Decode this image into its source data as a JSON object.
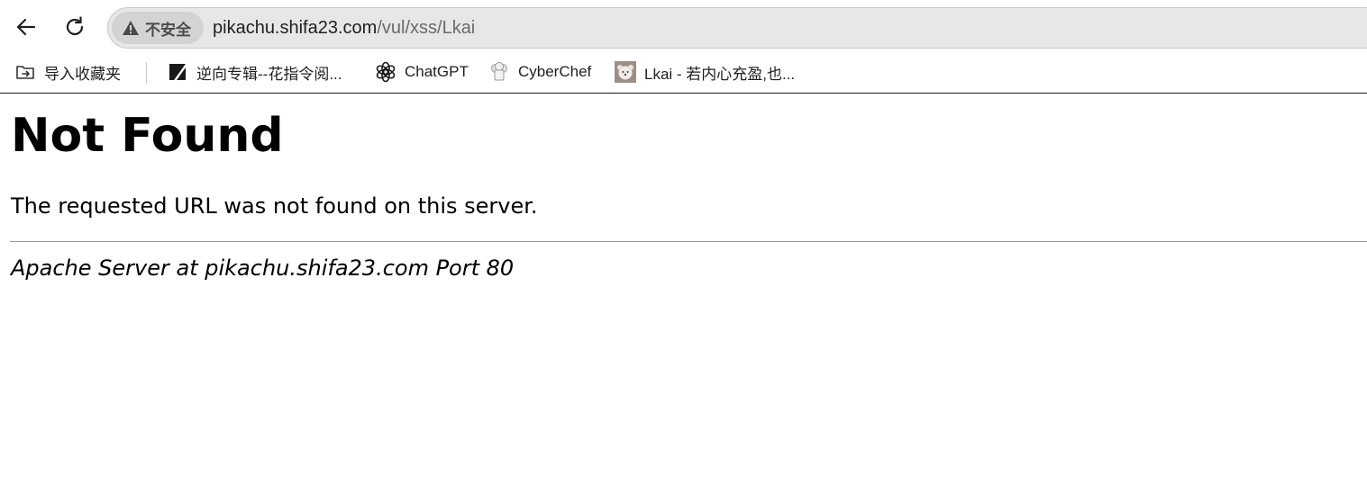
{
  "browser": {
    "security_label": "不安全",
    "url_host": "pikachu.shifa23.com",
    "url_path": "/vul/xss/Lkai",
    "icons": {
      "back": "back-arrow-icon",
      "reload": "reload-icon",
      "security": "warning-triangle-icon"
    }
  },
  "bookmarks": {
    "items": [
      {
        "label": "导入收藏夹",
        "icon": "import-favorites-icon"
      },
      {
        "label": "逆向专辑--花指令阅...",
        "icon": "site-favicon"
      },
      {
        "label": "ChatGPT",
        "icon": "chatgpt-icon"
      },
      {
        "label": "CyberChef",
        "icon": "cyberchef-icon"
      },
      {
        "label": "Lkai - 若内心充盈,也...",
        "icon": "avatar-favicon"
      }
    ]
  },
  "page": {
    "title": "Not Found",
    "message": "The requested URL was not found on this server.",
    "signature": "Apache Server at pikachu.shifa23.com Port 80"
  }
}
